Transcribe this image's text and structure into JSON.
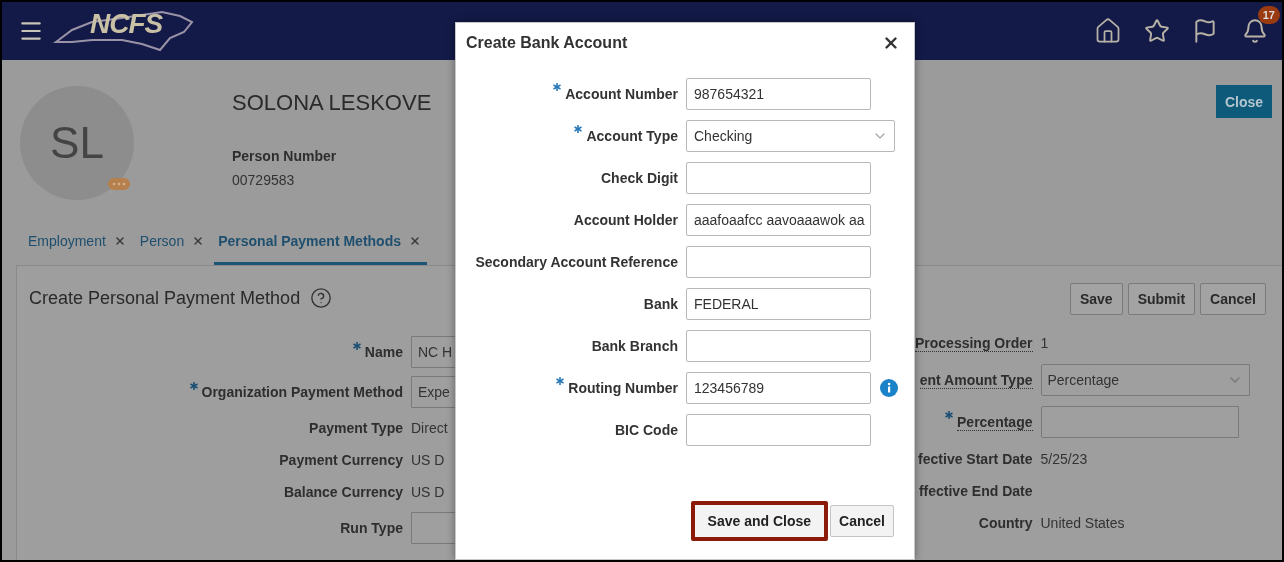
{
  "header": {
    "logo_text": "NCFS",
    "notification_count": "17"
  },
  "person": {
    "initials": "SL",
    "name": "SOLONA LESKOVE",
    "number_label": "Person Number",
    "number": "00729583"
  },
  "close_button": "Close",
  "tabs": [
    {
      "label": "Employment",
      "selected": false
    },
    {
      "label": "Person",
      "selected": false
    },
    {
      "label": "Personal Payment Methods",
      "selected": true
    }
  ],
  "form": {
    "title": "Create Personal Payment Method",
    "buttons": [
      "Save",
      "Submit",
      "Cancel"
    ],
    "left_fields": [
      {
        "label": "Name",
        "kind": "input",
        "required": true,
        "value": "NC H"
      },
      {
        "label": "Organization Payment Method",
        "kind": "input",
        "required": true,
        "value": "Expe"
      },
      {
        "label": "Payment Type",
        "kind": "text",
        "required": false,
        "value": "Direct"
      },
      {
        "label": "Payment Currency",
        "kind": "text",
        "required": false,
        "value": "US D"
      },
      {
        "label": "Balance Currency",
        "kind": "text",
        "required": false,
        "value": "US D"
      },
      {
        "label": "Run Type",
        "kind": "input",
        "required": false
      }
    ],
    "right_fields": [
      {
        "label": "Processing Order",
        "kind": "text",
        "required": false,
        "help": true,
        "value": "1"
      },
      {
        "label": "ent Amount Type",
        "kind": "select",
        "required": false,
        "help": true,
        "value": "Percentage"
      },
      {
        "label": "Percentage",
        "kind": "input",
        "required": true,
        "help": true
      },
      {
        "label": "fective Start Date",
        "kind": "text",
        "required": false,
        "help": false,
        "value": "5/25/23"
      },
      {
        "label": "ffective End Date",
        "kind": "text",
        "required": false,
        "help": false
      },
      {
        "label": "Country",
        "kind": "text",
        "required": false,
        "help": false,
        "value": "United States"
      }
    ]
  },
  "dialog": {
    "title": "Create Bank Account",
    "fields": [
      {
        "label": "Account Number",
        "kind": "input",
        "required": true,
        "info": false,
        "value": "987654321"
      },
      {
        "label": "Account Type",
        "kind": "select",
        "required": true,
        "info": false,
        "value": "Checking"
      },
      {
        "label": "Check Digit",
        "kind": "input",
        "required": false,
        "info": false
      },
      {
        "label": "Account Holder",
        "kind": "input",
        "required": false,
        "info": false,
        "value": "aaafoaafcc aavoaaawok aa"
      },
      {
        "label": "Secondary Account Reference",
        "kind": "input",
        "required": false,
        "info": false
      },
      {
        "label": "Bank",
        "kind": "input",
        "required": false,
        "info": false,
        "value": "FEDERAL"
      },
      {
        "label": "Bank Branch",
        "kind": "input",
        "required": false,
        "info": false
      },
      {
        "label": "Routing Number",
        "kind": "input",
        "required": true,
        "info": true,
        "value": "123456789"
      },
      {
        "label": "BIC Code",
        "kind": "input",
        "required": false,
        "info": false
      }
    ],
    "buttons": [
      {
        "label": "Save and Close",
        "highlighted": true
      },
      {
        "label": "Cancel",
        "highlighted": false
      }
    ]
  }
}
